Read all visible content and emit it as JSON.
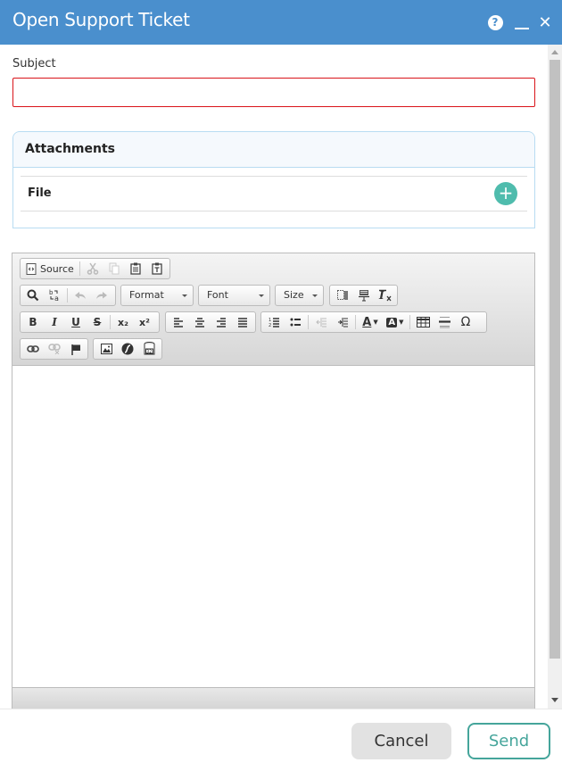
{
  "window": {
    "title": "Open Support Ticket",
    "help_glyph": "?",
    "close_glyph": "✕"
  },
  "form": {
    "subject_label": "Subject",
    "subject_value": "",
    "subject_placeholder": "",
    "attachments": {
      "title": "Attachments",
      "file_label": "File",
      "add_glyph": "+"
    }
  },
  "editor": {
    "toolbar": {
      "row1": [
        {
          "name": "source",
          "label": "Source",
          "icon": "source-icon",
          "enabled": true
        },
        {
          "name": "cut",
          "icon": "cut-icon",
          "enabled": false
        },
        {
          "name": "copy",
          "icon": "copy-icon",
          "enabled": false
        },
        {
          "name": "paste",
          "icon": "paste-icon",
          "enabled": true
        },
        {
          "name": "paste-text",
          "icon": "paste-text-icon",
          "enabled": true
        }
      ],
      "row2": [
        {
          "name": "find",
          "icon": "search-icon",
          "enabled": true
        },
        {
          "name": "replace",
          "icon": "replace-icon",
          "enabled": true
        },
        {
          "name": "undo",
          "icon": "undo-icon",
          "enabled": false
        },
        {
          "name": "redo",
          "icon": "redo-icon",
          "enabled": false
        }
      ],
      "combos": {
        "format": "Format",
        "font": "Font",
        "size": "Size"
      },
      "row2b": [
        {
          "name": "show-blocks",
          "icon": "show-blocks-icon"
        },
        {
          "name": "page-break",
          "icon": "page-break-icon"
        },
        {
          "name": "remove-format",
          "icon": "remove-format-icon"
        }
      ],
      "row3_basic": [
        {
          "name": "bold",
          "glyph": "B"
        },
        {
          "name": "italic",
          "glyph": "I"
        },
        {
          "name": "underline",
          "glyph": "U"
        },
        {
          "name": "strike",
          "glyph": "S"
        },
        {
          "name": "subscript",
          "glyph": "x₂"
        },
        {
          "name": "superscript",
          "glyph": "x²"
        }
      ],
      "row3_align": [
        "align-left",
        "align-center",
        "align-right",
        "align-justify"
      ],
      "row3_list": [
        {
          "name": "numbered-list"
        },
        {
          "name": "bulleted-list"
        },
        {
          "name": "outdent",
          "enabled": false
        },
        {
          "name": "indent"
        },
        {
          "name": "text-color",
          "glyph": "A"
        },
        {
          "name": "bg-color",
          "glyph": "A"
        },
        {
          "name": "table"
        },
        {
          "name": "horizontal-rule"
        },
        {
          "name": "special-char",
          "glyph": "Ω"
        }
      ],
      "row4": [
        "link",
        "unlink",
        "anchor",
        "image",
        "flash",
        "iframe"
      ]
    },
    "body_text": ""
  },
  "footer": {
    "cancel_label": "Cancel",
    "send_label": "Send"
  },
  "colors": {
    "title_bar": "#4a8fcd",
    "accent_teal": "#45a59b",
    "add_button": "#4fbcad",
    "error_border": "#d9141a",
    "panel_border": "#b8dcf2"
  }
}
